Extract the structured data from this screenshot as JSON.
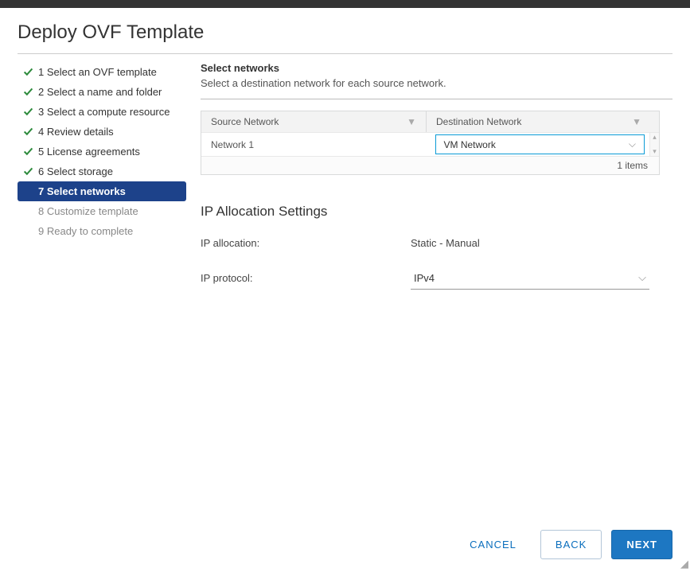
{
  "title": "Deploy OVF Template",
  "steps": [
    {
      "label": "1 Select an OVF template",
      "state": "done"
    },
    {
      "label": "2 Select a name and folder",
      "state": "done"
    },
    {
      "label": "3 Select a compute resource",
      "state": "done"
    },
    {
      "label": "4 Review details",
      "state": "done"
    },
    {
      "label": "5 License agreements",
      "state": "done"
    },
    {
      "label": "6 Select storage",
      "state": "done"
    },
    {
      "label": "7 Select networks",
      "state": "active"
    },
    {
      "label": "8 Customize template",
      "state": "pending"
    },
    {
      "label": "9 Ready to complete",
      "state": "pending"
    }
  ],
  "panel": {
    "heading": "Select networks",
    "sub": "Select a destination network for each source network."
  },
  "table": {
    "col1": "Source Network",
    "col2": "Destination Network",
    "row1_source": "Network 1",
    "row1_dest": "VM Network",
    "footer": "1 items"
  },
  "ip": {
    "heading": "IP Allocation Settings",
    "alloc_label": "IP allocation:",
    "alloc_value": "Static - Manual",
    "proto_label": "IP protocol:",
    "proto_value": "IPv4"
  },
  "buttons": {
    "cancel": "CANCEL",
    "back": "BACK",
    "next": "NEXT"
  }
}
